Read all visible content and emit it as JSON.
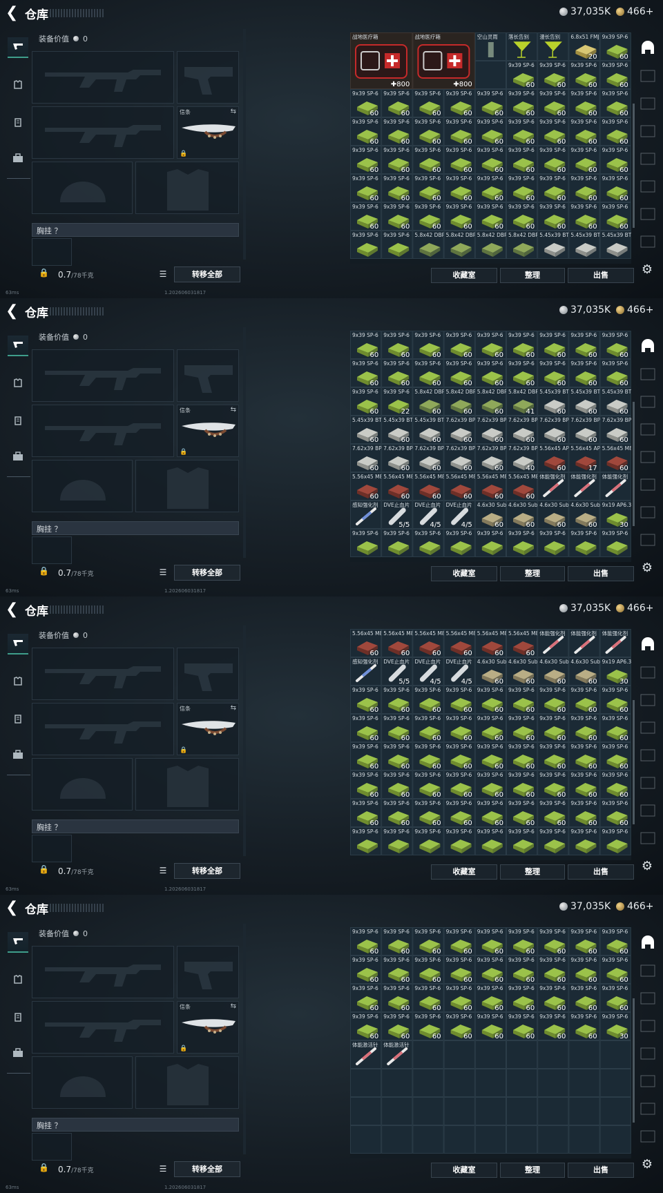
{
  "header": {
    "title": "仓库",
    "silver": "37,035K",
    "gold": "466+"
  },
  "left": {
    "equip_value_label": "装备价值",
    "equip_value": "0",
    "melee_tag": "信条",
    "chest_rig_label": "胸挂 ？",
    "weight_value": "0.7",
    "weight_unit": "/78千克",
    "transfer_label": "转移全部"
  },
  "buttons": {
    "collection": "收藏室",
    "organize": "整理",
    "sell": "出售"
  },
  "status": {
    "ping": "63ms",
    "build": "1.202606031817"
  },
  "screens": [
    {
      "rows": [
        [
          "MED|战地医疗箱|800",
          "",
          "MED|战地医疗箱|800",
          "",
          "BOT|空山灵雨|",
          "COCK|落长告别|",
          "COCK|漫长告别|",
          "GB|6.8x51 FMJ|20",
          "A|9x39 SP-6|60"
        ],
        [
          "",
          "",
          "",
          "",
          "",
          "A|9x39 SP-6|60",
          "A|9x39 SP-6|60",
          "A|9x39 SP-6|60",
          "A|9x39 SP-6|60"
        ],
        [
          "A|9x39 SP-6|60",
          "A|9x39 SP-6|60",
          "A|9x39 SP-6|60",
          "A|9x39 SP-6|60",
          "A|9x39 SP-6|60",
          "A|9x39 SP-6|60",
          "A|9x39 SP-6|60",
          "A|9x39 SP-6|60",
          "A|9x39 SP-6|60"
        ],
        [
          "A|9x39 SP-6|60",
          "A|9x39 SP-6|60",
          "A|9x39 SP-6|60",
          "A|9x39 SP-6|60",
          "A|9x39 SP-6|60",
          "A|9x39 SP-6|60",
          "A|9x39 SP-6|60",
          "A|9x39 SP-6|60",
          "A|9x39 SP-6|60"
        ],
        [
          "A|9x39 SP-6|60",
          "A|9x39 SP-6|60",
          "A|9x39 SP-6|60",
          "A|9x39 SP-6|60",
          "A|9x39 SP-6|60",
          "A|9x39 SP-6|60",
          "A|9x39 SP-6|60",
          "A|9x39 SP-6|60",
          "A|9x39 SP-6|60"
        ],
        [
          "A|9x39 SP-6|60",
          "A|9x39 SP-6|60",
          "A|9x39 SP-6|60",
          "A|9x39 SP-6|60",
          "A|9x39 SP-6|60",
          "A|9x39 SP-6|60",
          "A|9x39 SP-6|60",
          "A|9x39 SP-6|60",
          "A|9x39 SP-6|60"
        ],
        [
          "A|9x39 SP-6|60",
          "A|9x39 SP-6|60",
          "A|9x39 SP-6|60",
          "A|9x39 SP-6|60",
          "A|9x39 SP-6|60",
          "A|9x39 SP-6|60",
          "A|9x39 SP-6|60",
          "A|9x39 SP-6|60",
          "A|9x39 SP-6|60"
        ],
        [
          "A|9x39 SP-6|",
          "A|9x39 SP-6|",
          "G|5.8x42 DBP10|",
          "G|5.8x42 DBP10|",
          "G|5.8x42 DBP10|",
          "G|5.8x42 DBP10|",
          "W|5.45x39 BT|",
          "W|5.45x39 BT|",
          "W|5.45x39 BT|"
        ]
      ]
    },
    {
      "rows": [
        [
          "A|9x39 SP-6|60",
          "A|9x39 SP-6|60",
          "A|9x39 SP-6|60",
          "A|9x39 SP-6|60",
          "A|9x39 SP-6|60",
          "A|9x39 SP-6|60",
          "A|9x39 SP-6|60",
          "A|9x39 SP-6|60",
          "A|9x39 SP-6|60"
        ],
        [
          "A|9x39 SP-6|60",
          "A|9x39 SP-6|60",
          "A|9x39 SP-6|60",
          "A|9x39 SP-6|60",
          "A|9x39 SP-6|60",
          "A|9x39 SP-6|60",
          "A|9x39 SP-6|60",
          "A|9x39 SP-6|60",
          "A|9x39 SP-6|60"
        ],
        [
          "A|9x39 SP-6|60",
          "A|9x39 SP-6|22",
          "G|5.8x42 DBP10|60",
          "G|5.8x42 DBP10|60",
          "G|5.8x42 DBP10|60",
          "G|5.8x42 DBP10|41",
          "W|5.45x39 BT|60",
          "W|5.45x39 BT|60",
          "W|5.45x39 BT|60"
        ],
        [
          "W|5.45x39 BT|60",
          "W|5.45x39 BT|60",
          "W|5.45x39 BT|60",
          "W|7.62x39 BP|60",
          "W|7.62x39 BP|60",
          "W|7.62x39 BP|60",
          "W|7.62x39 BP|60",
          "W|7.62x39 BP|60",
          "W|7.62x39 BP|60"
        ],
        [
          "W|7.62x39 BP|60",
          "W|7.62x39 BP|60",
          "W|7.62x39 BP|60",
          "W|7.62x39 BP|60",
          "W|7.62x39 BP|60",
          "W|7.62x39 BP|40",
          "R|5.56x45 AP|60",
          "R|5.56x45 AP|17",
          "R|5.56x45 M855A1|60"
        ],
        [
          "R|5.56x45 M855A1|60",
          "R|5.56x45 M855A1|60",
          "R|5.56x45 M855A1|60",
          "R|5.56x45 M855A1|60",
          "R|5.56x45 M855A1|60",
          "R|5.56x45 M855A1|60",
          "INJ|体能强化剂|",
          "INJ|体能强化剂|",
          "INJ|体能强化剂|"
        ],
        [
          "INJB|感知强化剂|",
          "BAND|DVE止血片|5/5",
          "BAND|DVE止血片|4/5",
          "BAND|DVE止血片|4/5",
          "B|4.6x30 Subsonic|60",
          "B|4.6x30 Subsonic|60",
          "B|4.6x30 Subsonic|60",
          "B|4.6x30 Subsonic|60",
          "A|9x19 AP6.3|30"
        ],
        [
          "A|9x39 SP-6|",
          "A|9x39 SP-6|",
          "A|9x39 SP-6|",
          "A|9x39 SP-6|",
          "A|9x39 SP-6|",
          "A|9x39 SP-6|",
          "A|9x39 SP-6|",
          "A|9x39 SP-6|",
          "A|9x39 SP-6|"
        ]
      ]
    },
    {
      "rows": [
        [
          "R|5.56x45 M855A1|60",
          "R|5.56x45 M855A1|60",
          "R|5.56x45 M855A1|60",
          "R|5.56x45 M855A1|60",
          "R|5.56x45 M855A1|60",
          "R|5.56x45 M855A1|60",
          "INJ|体能强化剂|",
          "INJ|体能强化剂|",
          "INJ|体能强化剂|"
        ],
        [
          "INJB|感知强化剂|",
          "BAND|DVE止血片|5/5",
          "BAND|DVE止血片|4/5",
          "BAND|DVE止血片|4/5",
          "B|4.6x30 Subsonic|60",
          "B|4.6x30 Subsonic|60",
          "B|4.6x30 Subsonic|60",
          "B|4.6x30 Subsonic|60",
          "A|9x19 AP6.3|30"
        ],
        [
          "A|9x39 SP-6|60",
          "A|9x39 SP-6|60",
          "A|9x39 SP-6|60",
          "A|9x39 SP-6|60",
          "A|9x39 SP-6|60",
          "A|9x39 SP-6|60",
          "A|9x39 SP-6|60",
          "A|9x39 SP-6|60",
          "A|9x39 SP-6|60"
        ],
        [
          "A|9x39 SP-6|60",
          "A|9x39 SP-6|60",
          "A|9x39 SP-6|60",
          "A|9x39 SP-6|60",
          "A|9x39 SP-6|60",
          "A|9x39 SP-6|60",
          "A|9x39 SP-6|60",
          "A|9x39 SP-6|60",
          "A|9x39 SP-6|60"
        ],
        [
          "A|9x39 SP-6|60",
          "A|9x39 SP-6|60",
          "A|9x39 SP-6|60",
          "A|9x39 SP-6|60",
          "A|9x39 SP-6|60",
          "A|9x39 SP-6|60",
          "A|9x39 SP-6|60",
          "A|9x39 SP-6|60",
          "A|9x39 SP-6|60"
        ],
        [
          "A|9x39 SP-6|60",
          "A|9x39 SP-6|60",
          "A|9x39 SP-6|60",
          "A|9x39 SP-6|60",
          "A|9x39 SP-6|60",
          "A|9x39 SP-6|60",
          "A|9x39 SP-6|60",
          "A|9x39 SP-6|60",
          "A|9x39 SP-6|60"
        ],
        [
          "A|9x39 SP-6|60",
          "A|9x39 SP-6|60",
          "A|9x39 SP-6|60",
          "A|9x39 SP-6|60",
          "A|9x39 SP-6|60",
          "A|9x39 SP-6|60",
          "A|9x39 SP-6|60",
          "A|9x39 SP-6|60",
          "A|9x39 SP-6|60"
        ],
        [
          "A|9x39 SP-6|",
          "A|9x39 SP-6|",
          "A|9x39 SP-6|",
          "A|9x39 SP-6|",
          "A|9x39 SP-6|",
          "A|9x39 SP-6|",
          "A|9x39 SP-6|",
          "A|9x39 SP-6|",
          "A|9x39 SP-6|"
        ]
      ]
    },
    {
      "rows": [
        [
          "A|9x39 SP-6|60",
          "A|9x39 SP-6|60",
          "A|9x39 SP-6|60",
          "A|9x39 SP-6|60",
          "A|9x39 SP-6|60",
          "A|9x39 SP-6|60",
          "A|9x39 SP-6|60",
          "A|9x39 SP-6|60",
          "A|9x39 SP-6|60"
        ],
        [
          "A|9x39 SP-6|60",
          "A|9x39 SP-6|60",
          "A|9x39 SP-6|60",
          "A|9x39 SP-6|60",
          "A|9x39 SP-6|60",
          "A|9x39 SP-6|60",
          "A|9x39 SP-6|60",
          "A|9x39 SP-6|60",
          "A|9x39 SP-6|60"
        ],
        [
          "A|9x39 SP-6|60",
          "A|9x39 SP-6|60",
          "A|9x39 SP-6|60",
          "A|9x39 SP-6|60",
          "A|9x39 SP-6|60",
          "A|9x39 SP-6|60",
          "A|9x39 SP-6|60",
          "A|9x39 SP-6|60",
          "A|9x39 SP-6|60"
        ],
        [
          "A|9x39 SP-6|60",
          "A|9x39 SP-6|60",
          "A|9x39 SP-6|60",
          "A|9x39 SP-6|60",
          "A|9x39 SP-6|60",
          "A|9x39 SP-6|60",
          "A|9x39 SP-6|60",
          "A|9x39 SP-6|60",
          "A|9x39 SP-6|30"
        ],
        [
          "INJ|体能激活针|",
          "INJ|体能激活针|",
          "",
          "",
          "",
          "",
          "",
          "",
          ""
        ],
        [
          "",
          "",
          "",
          "",
          "",
          "",
          "",
          "",
          ""
        ],
        [
          "",
          "",
          "",
          "",
          "",
          "",
          "",
          "",
          ""
        ],
        [
          "",
          "",
          "",
          "",
          "",
          "",
          "",
          "",
          ""
        ]
      ]
    }
  ],
  "colors": {
    "accent": "#3f9e8b",
    "ammo_green": "#9bc24a",
    "ammo_red": "#a0483c",
    "ammo_white": "#c9cbc6",
    "ammo_tan": "#b9ad85",
    "medkit_red": "#c62a2a"
  },
  "icons": {
    "back": "back-arrow-icon",
    "weapons_tab": "pistol-icon",
    "armor_tab": "armor-icon",
    "rig_tab": "rig-icon",
    "backpack_tab": "backpack-icon",
    "lock": "lock-icon",
    "settings": "gear-icon"
  }
}
